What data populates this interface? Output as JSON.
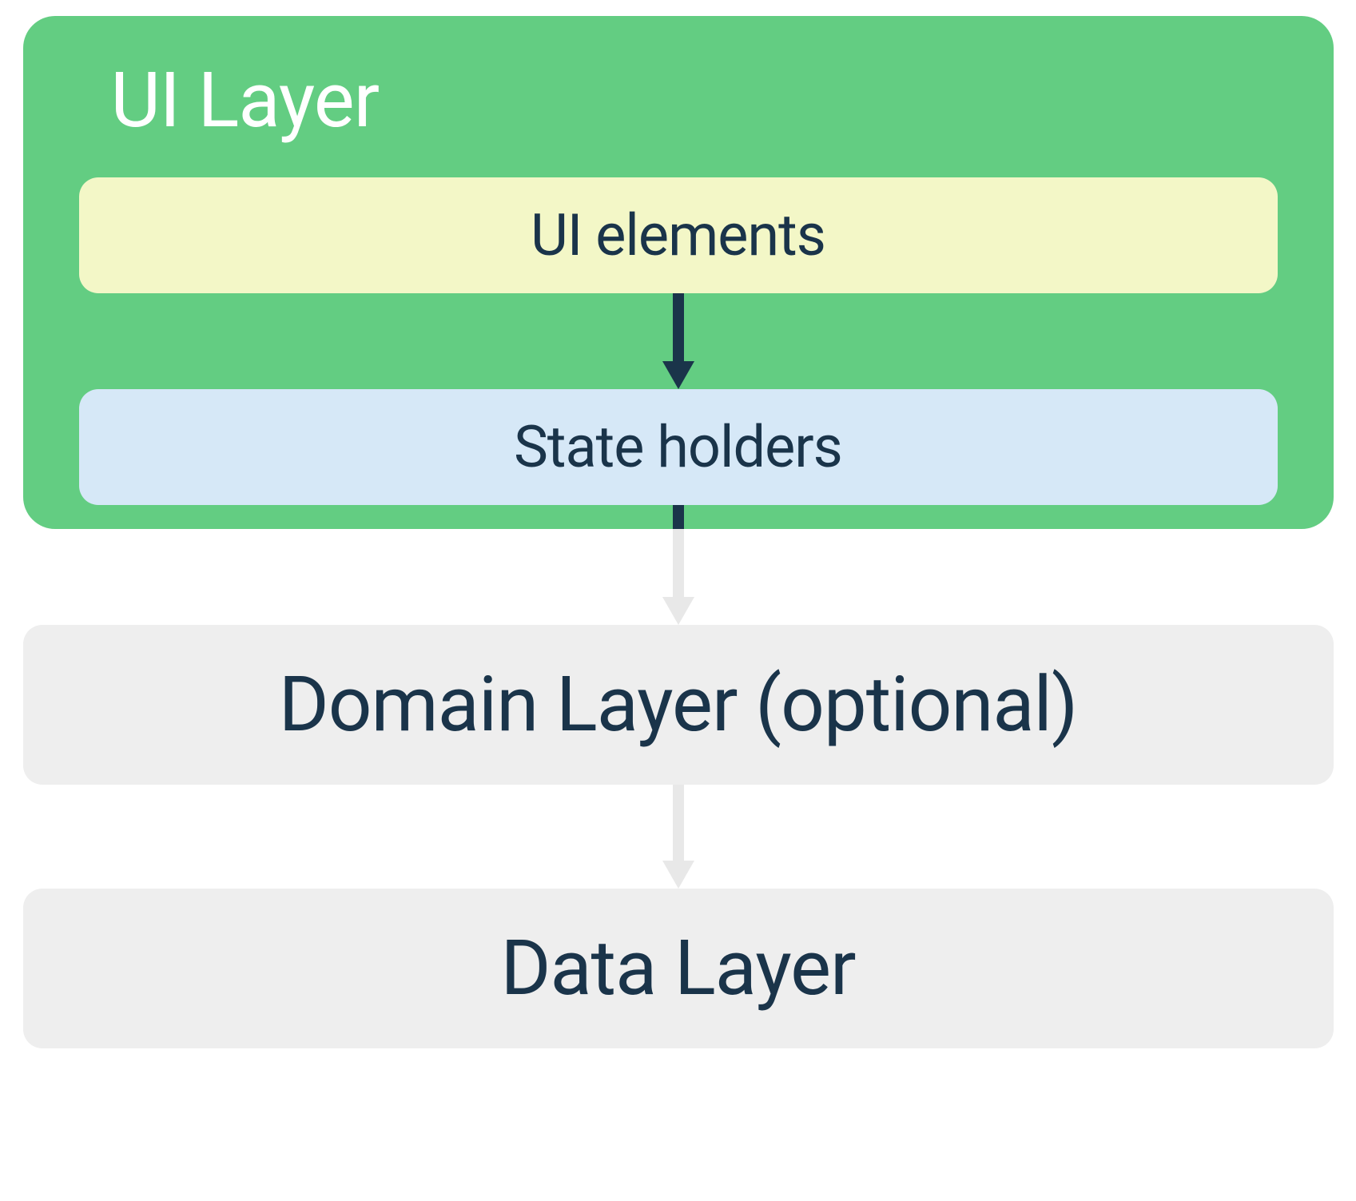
{
  "colors": {
    "green": "#63cd82",
    "yellow": "#f3f7c7",
    "lightBlue": "#d6e8f7",
    "grey": "#eeeeee",
    "darkNavy": "#1a344a",
    "arrowDark": "#1a344a",
    "arrowLight": "#e8e8e8",
    "white": "#ffffff"
  },
  "uiLayer": {
    "title": "UI Layer",
    "uiElements": "UI elements",
    "stateHolders": "State holders"
  },
  "domainLayer": {
    "label": "Domain Layer (optional)"
  },
  "dataLayer": {
    "label": "Data Layer"
  }
}
